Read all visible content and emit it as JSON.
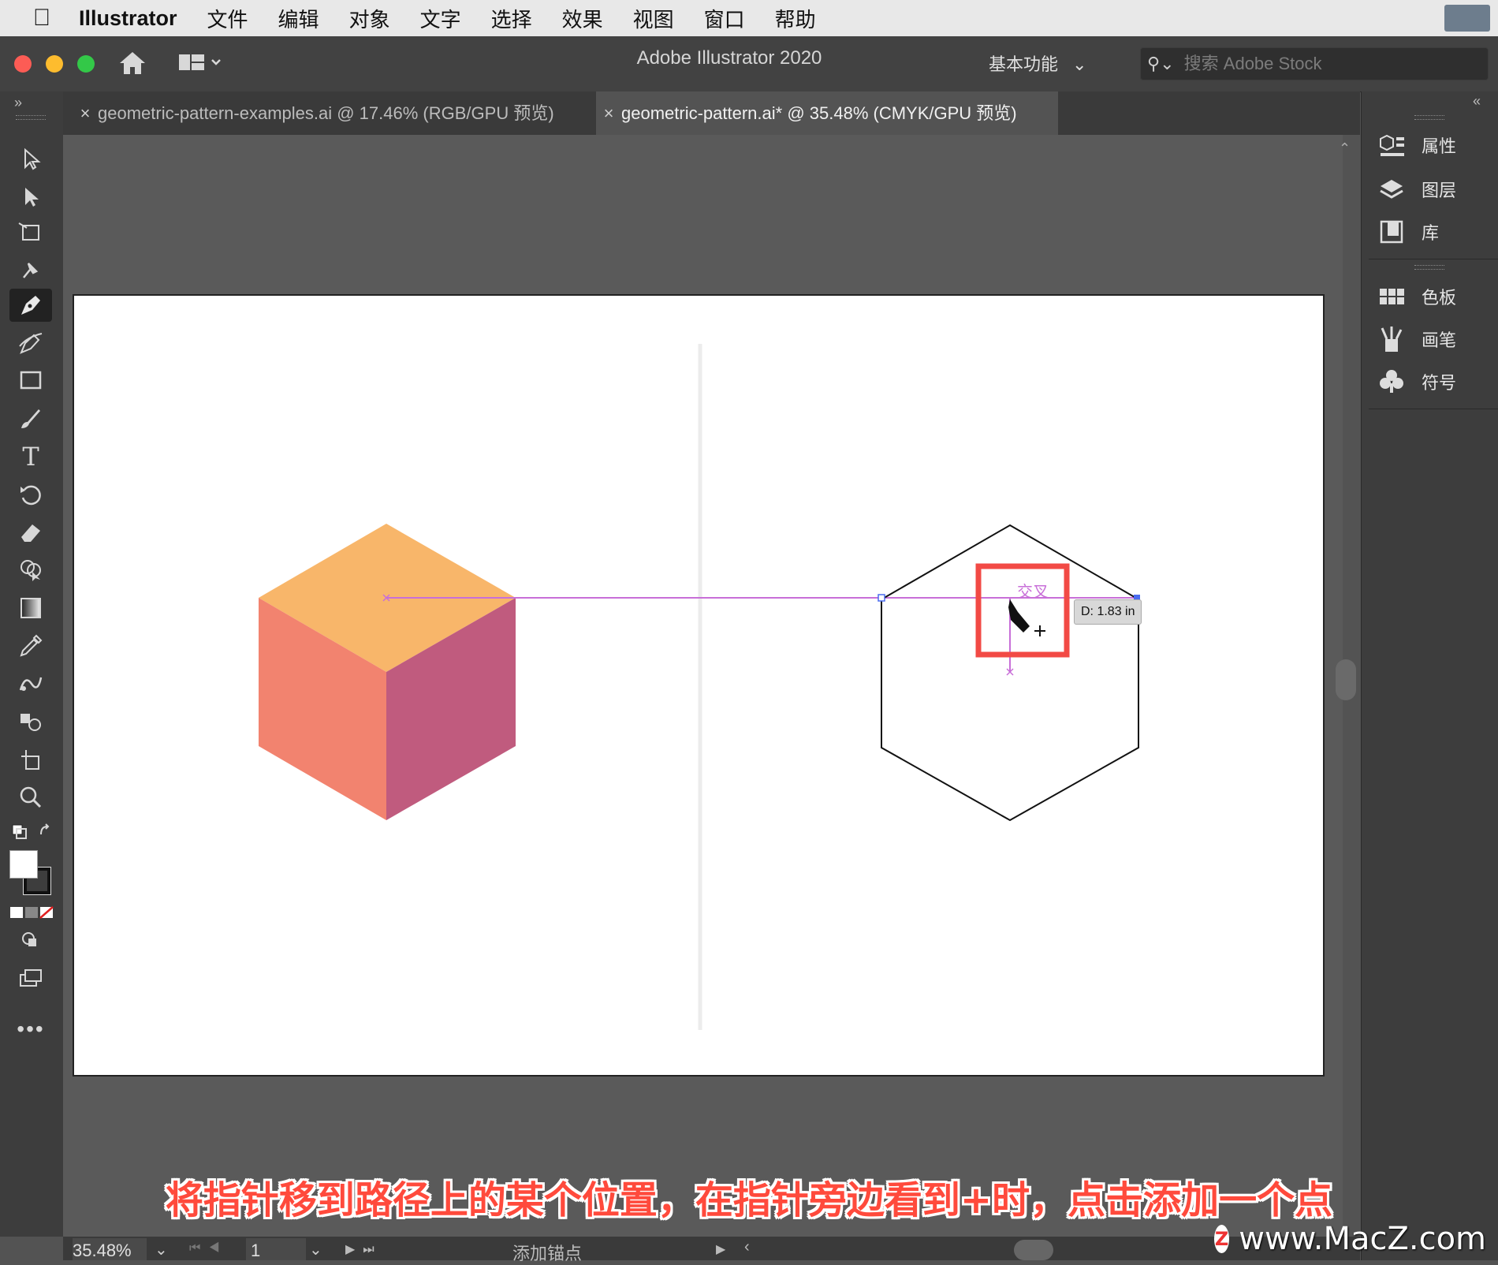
{
  "menubar": {
    "app_name": "Illustrator",
    "items": [
      "文件",
      "编辑",
      "对象",
      "文字",
      "选择",
      "效果",
      "视图",
      "窗口",
      "帮助"
    ]
  },
  "appbar": {
    "title": "Adobe Illustrator 2020",
    "workspace": "基本功能",
    "search_placeholder": "搜索 Adobe Stock"
  },
  "tabs": [
    {
      "label": "geometric-pattern-examples.ai @ 17.46% (RGB/GPU 预览)",
      "active": false
    },
    {
      "label": "geometric-pattern.ai* @ 35.48% (CMYK/GPU 预览)",
      "active": true
    }
  ],
  "canvas": {
    "smart_guide_label": "交叉",
    "distance_tooltip": "D: 1.83 in",
    "colors": {
      "cube_top": "#f8b66a",
      "cube_left": "#f2836f",
      "cube_right": "#c05b7e",
      "guide": "#c86fd8",
      "highlight": "#f24a45"
    }
  },
  "dock": {
    "items": [
      {
        "label": "属性",
        "icon": "properties-icon"
      },
      {
        "label": "图层",
        "icon": "layers-icon"
      },
      {
        "label": "库",
        "icon": "libraries-icon"
      },
      {
        "label": "色板",
        "icon": "swatches-icon"
      },
      {
        "label": "画笔",
        "icon": "brushes-icon"
      },
      {
        "label": "符号",
        "icon": "symbols-icon"
      }
    ]
  },
  "statusbar": {
    "zoom": "35.48%",
    "artboard_number": "1",
    "tool_status": "添加锚点"
  },
  "caption": "将指针移到路径上的某个位置，在指针旁边看到+时，点击添加一个点",
  "watermark": "www.MacZ.com"
}
